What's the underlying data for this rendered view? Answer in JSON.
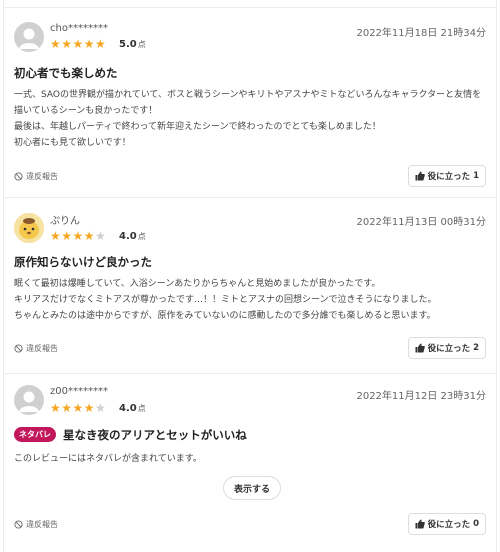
{
  "reviews": [
    {
      "user": "cho********",
      "stars": "★★★★★",
      "stars_empty": "",
      "rating": "5.0",
      "date": "2022年11月18日 21時34分",
      "title": "初心者でも楽しめた",
      "body": [
        "一式、SAOの世界観が描かれていて、ボスと戦うシーンやキリトやアスナやミトなどいろんなキャラクターと友情を描いているシーンも良かったです！",
        "最後は、年越しパーティで終わって新年迎えたシーンで終わったのでとても楽しめました！",
        "初心者にも見て欲しいです！"
      ],
      "helpful_count": "1"
    },
    {
      "user": "ぷりん",
      "stars": "★★★★",
      "stars_empty": "★",
      "rating": "4.0",
      "date": "2022年11月13日 00時31分",
      "title": "原作知らないけど良かった",
      "body": [
        "眠くて最初は爆睡していて、入浴シーンあたりからちゃんと見始めましたが良かったです。",
        "キリアスだけでなくミトアスが尊かったです…！！ミトとアスナの回想シーンで泣きそうになりました。",
        "ちゃんとみたのは途中からですが、原作をみていないのに感動したので多分誰でも楽しめると思います。"
      ],
      "helpful_count": "2"
    },
    {
      "user": "z00********",
      "stars": "★★★★",
      "stars_empty": "★",
      "rating": "4.0",
      "date": "2022年11月12日 23時31分",
      "spoiler_tag": "ネタバレ",
      "title": "星なき夜のアリアとセットがいいね",
      "body": [
        "このレビューにはネタバレが含まれています。"
      ],
      "show_label": "表示する",
      "helpful_count": "0"
    }
  ],
  "labels": {
    "rating_unit": "点",
    "report": "違反報告",
    "helpful": "役に立った"
  },
  "colors": {
    "star": "#f5a623",
    "spoiler": "#c2185b"
  }
}
